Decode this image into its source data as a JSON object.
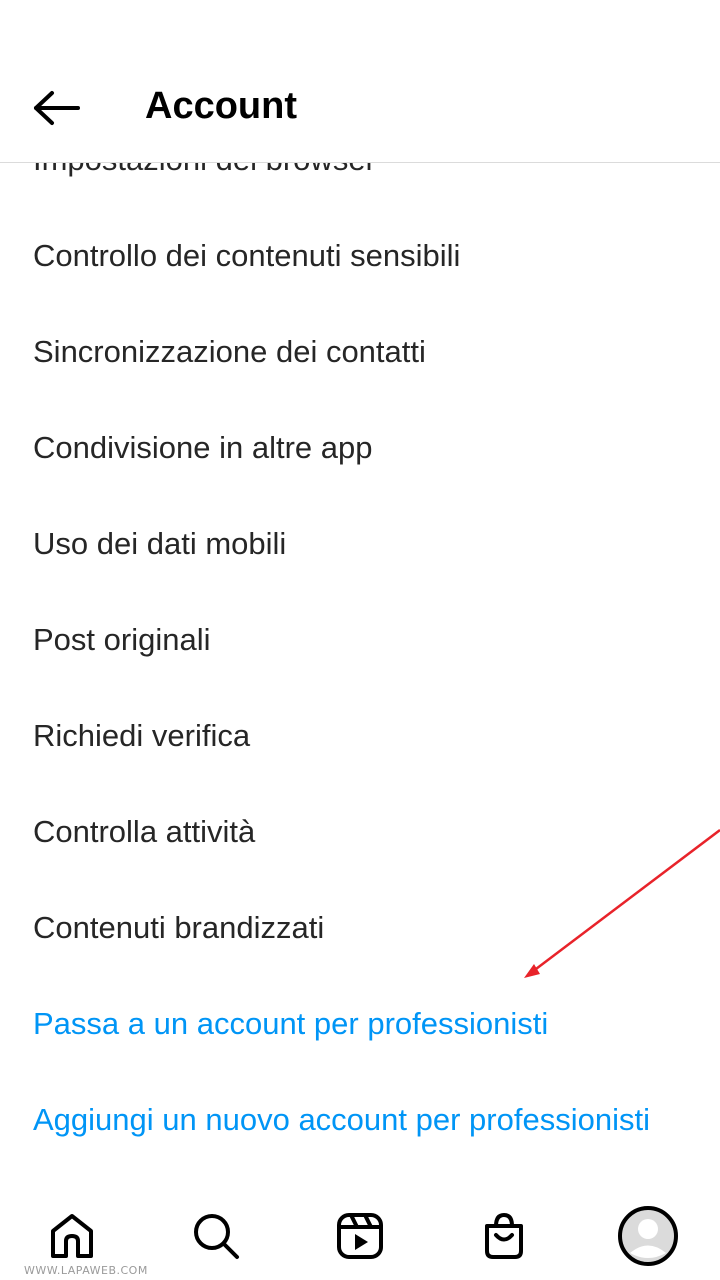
{
  "header": {
    "title": "Account",
    "back_icon": "arrow-left-icon"
  },
  "menu": {
    "items": [
      {
        "label": "Impostazioni del browser",
        "type": "normal"
      },
      {
        "label": "Controllo dei contenuti sensibili",
        "type": "normal"
      },
      {
        "label": "Sincronizzazione dei contatti",
        "type": "normal"
      },
      {
        "label": "Condivisione in altre app",
        "type": "normal"
      },
      {
        "label": "Uso dei dati mobili",
        "type": "normal"
      },
      {
        "label": "Post originali",
        "type": "normal"
      },
      {
        "label": "Richiedi verifica",
        "type": "normal"
      },
      {
        "label": "Controlla attività",
        "type": "normal"
      },
      {
        "label": "Contenuti brandizzati",
        "type": "normal"
      },
      {
        "label": "Passa a un account per professionisti",
        "type": "link"
      },
      {
        "label": "Aggiungi un nuovo account per professionisti",
        "type": "link"
      }
    ]
  },
  "annotation": {
    "arrow_color": "#e8232a"
  },
  "bottom_nav": {
    "items": [
      "home-icon",
      "search-icon",
      "reels-icon",
      "shop-icon",
      "profile-avatar"
    ]
  },
  "watermark": "WWW.LAPAWEB.COM",
  "colors": {
    "link": "#0095f6",
    "text": "#262626",
    "divider": "#dbdbdb"
  }
}
